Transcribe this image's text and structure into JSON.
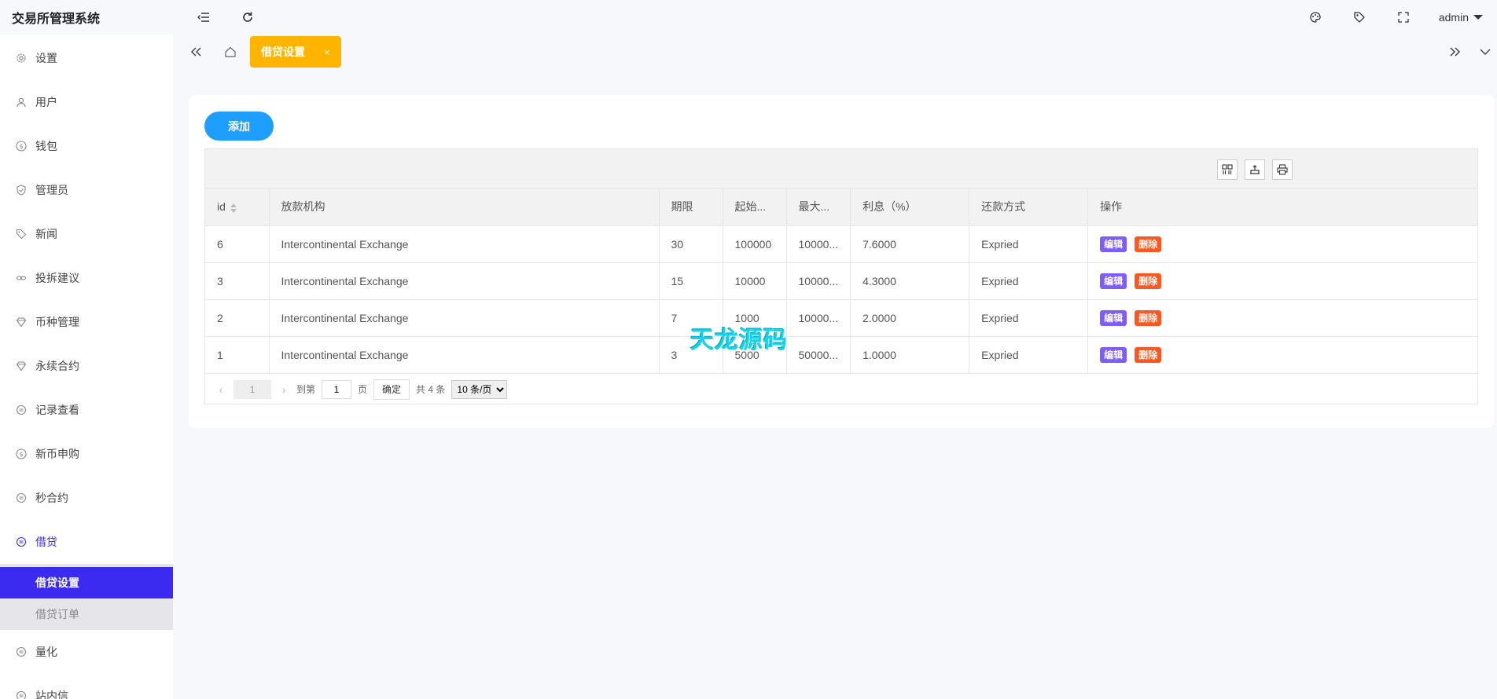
{
  "app": {
    "title": "交易所管理系统"
  },
  "header": {
    "user": "admin"
  },
  "sidebar": {
    "items": [
      {
        "label": "设置",
        "icon": "gear-icon"
      },
      {
        "label": "用户",
        "icon": "user-icon"
      },
      {
        "label": "钱包",
        "icon": "dollar-icon"
      },
      {
        "label": "管理员",
        "icon": "shield-icon"
      },
      {
        "label": "新闻",
        "icon": "tag-icon"
      },
      {
        "label": "投拆建议",
        "icon": "link-icon"
      },
      {
        "label": "币种管理",
        "icon": "diamond-icon"
      },
      {
        "label": "永续合约",
        "icon": "diamond-icon"
      },
      {
        "label": "记录查看",
        "icon": "swap-icon"
      },
      {
        "label": "新币申购",
        "icon": "dollar-icon"
      },
      {
        "label": "秒合约",
        "icon": "swap-icon"
      },
      {
        "label": "借贷",
        "icon": "swap-icon"
      }
    ],
    "submenu": [
      {
        "label": "借贷设置"
      },
      {
        "label": "借贷订单"
      }
    ],
    "after": [
      {
        "label": "量化",
        "icon": "swap-icon"
      },
      {
        "label": "站内信",
        "icon": "swap-icon"
      }
    ]
  },
  "tabs": {
    "active_label": "借贷设置",
    "close": "×"
  },
  "main": {
    "add_label": "添加",
    "columns": [
      "id",
      "放款机构",
      "期限",
      "起始...",
      "最大...",
      "利息（%）",
      "还款方式",
      "操作"
    ],
    "rows": [
      {
        "id": "6",
        "org": "Intercontinental Exchange",
        "term": "30",
        "min": "100000",
        "max": "10000...",
        "rate": "7.6000",
        "repay": "Expried"
      },
      {
        "id": "3",
        "org": "Intercontinental Exchange",
        "term": "15",
        "min": "10000",
        "max": "10000...",
        "rate": "4.3000",
        "repay": "Expried"
      },
      {
        "id": "2",
        "org": "Intercontinental Exchange",
        "term": "7",
        "min": "1000",
        "max": "10000...",
        "rate": "2.0000",
        "repay": "Expried"
      },
      {
        "id": "1",
        "org": "Intercontinental Exchange",
        "term": "3",
        "min": "5000",
        "max": "50000...",
        "rate": "1.0000",
        "repay": "Expried"
      }
    ],
    "actions": {
      "edit": "编辑",
      "delete": "删除"
    },
    "pager": {
      "current": "1",
      "goto": "到第",
      "goto_value": "1",
      "page_unit": "页",
      "confirm": "确定",
      "total": "共 4 条",
      "per_page": "10 条/页"
    }
  },
  "watermark": "天龙源码",
  "colors": {
    "accent": "#3b2bf0",
    "tab": "#ffb400",
    "add": "#1e9fff",
    "edit": "#7e5cff",
    "delete": "#ff5722"
  }
}
